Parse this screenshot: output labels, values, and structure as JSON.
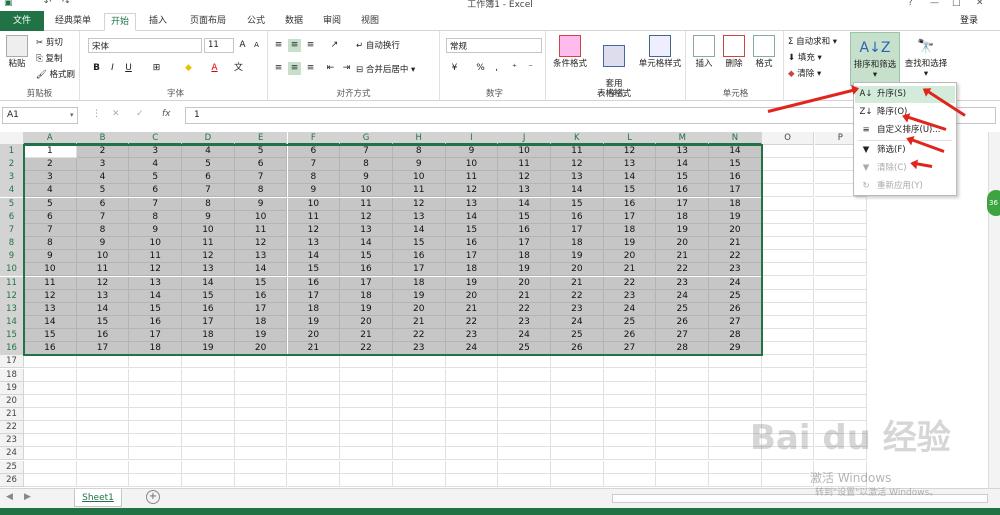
{
  "title": {
    "text": "工作簿1 - Excel"
  },
  "tabs": [
    {
      "id": "file",
      "label": "文件"
    },
    {
      "id": "classic",
      "label": "经典菜单"
    },
    {
      "id": "home",
      "label": "开始"
    },
    {
      "id": "insert",
      "label": "插入"
    },
    {
      "id": "layout",
      "label": "页面布局"
    },
    {
      "id": "formula",
      "label": "公式"
    },
    {
      "id": "data",
      "label": "数据"
    },
    {
      "id": "review",
      "label": "审阅"
    },
    {
      "id": "view",
      "label": "视图"
    }
  ],
  "login": "登录",
  "ribbon": {
    "clipboard": {
      "label": "剪贴板",
      "paste": "粘贴",
      "cut": "剪切",
      "copy": "复制",
      "painter": "格式刷"
    },
    "font": {
      "label": "字体",
      "name": "宋体",
      "size": "11",
      "bold": "B",
      "italic": "I",
      "underline": "U"
    },
    "align": {
      "label": "对齐方式",
      "wrap": "自动换行",
      "merge": "合并后居中"
    },
    "number": {
      "label": "数字",
      "format": "常规",
      "percent": "%",
      "comma": ","
    },
    "styles": {
      "label": "样式",
      "cond": "条件格式",
      "table": "套用\n表格格式",
      "cell": "单元格样式"
    },
    "cells": {
      "label": "单元格",
      "insert": "插入",
      "delete": "删除",
      "format": "格式"
    },
    "editing": {
      "autosum": "自动求和",
      "fill": "填充",
      "clear": "清除",
      "sort": "排序和筛选",
      "find": "查找和选择"
    }
  },
  "formula_bar": {
    "name_box": "A1",
    "fx": "fx",
    "value": "1"
  },
  "columns": [
    "A",
    "B",
    "C",
    "D",
    "E",
    "F",
    "G",
    "H",
    "I",
    "J",
    "K",
    "L",
    "M",
    "N",
    "O",
    "P"
  ],
  "row_count": 26,
  "data_rows": 16,
  "sheet": {
    "tab": "Sheet1",
    "add": "+"
  },
  "menu": {
    "items": [
      {
        "label": "升序(S)",
        "icon": "A↓",
        "state": "highlight"
      },
      {
        "label": "降序(O)",
        "icon": "Z↓",
        "state": "normal"
      },
      {
        "label": "自定义排序(U)...",
        "icon": "≡",
        "state": "normal"
      },
      {
        "label": "筛选(F)",
        "icon": "▼",
        "state": "normal"
      },
      {
        "label": "清除(C)",
        "icon": "▼",
        "state": "disabled"
      },
      {
        "label": "重新应用(Y)",
        "icon": "↻",
        "state": "disabled"
      }
    ]
  },
  "watermark": {
    "brand": "Bai du 经验",
    "act1": "激活 Windows",
    "act2": "转到\"设置\"以激活 Windows。"
  },
  "colors": {
    "accent": "#217346",
    "selection": "#c6c6c6",
    "menu_highlight": "#d3ebda",
    "arrow": "#e0261c"
  }
}
